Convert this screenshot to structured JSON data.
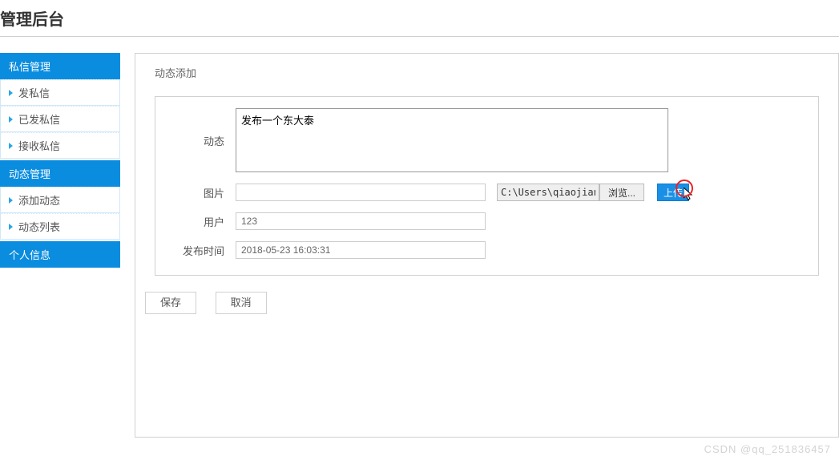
{
  "page_title": "管理后台",
  "sidebar": {
    "sections": [
      {
        "header": "私信管理",
        "items": [
          "发私信",
          "已发私信",
          "接收私信"
        ]
      },
      {
        "header": "动态管理",
        "items": [
          "添加动态",
          "动态列表"
        ]
      },
      {
        "header": "个人信息",
        "items": []
      }
    ]
  },
  "panel": {
    "title": "动态添加"
  },
  "form": {
    "dynamic_label": "动态",
    "dynamic_value": "发布一个东大泰",
    "image_label": "图片",
    "image_value": "",
    "file_path": "C:\\Users\\qiaojian\\Pict",
    "browse_label": "浏览...",
    "upload_label": "上传",
    "user_label": "用户",
    "user_value": "123",
    "time_label": "发布时间",
    "time_value": "2018-05-23 16:03:31"
  },
  "buttons": {
    "save": "保存",
    "cancel": "取消"
  },
  "watermark": "CSDN @qq_251836457"
}
